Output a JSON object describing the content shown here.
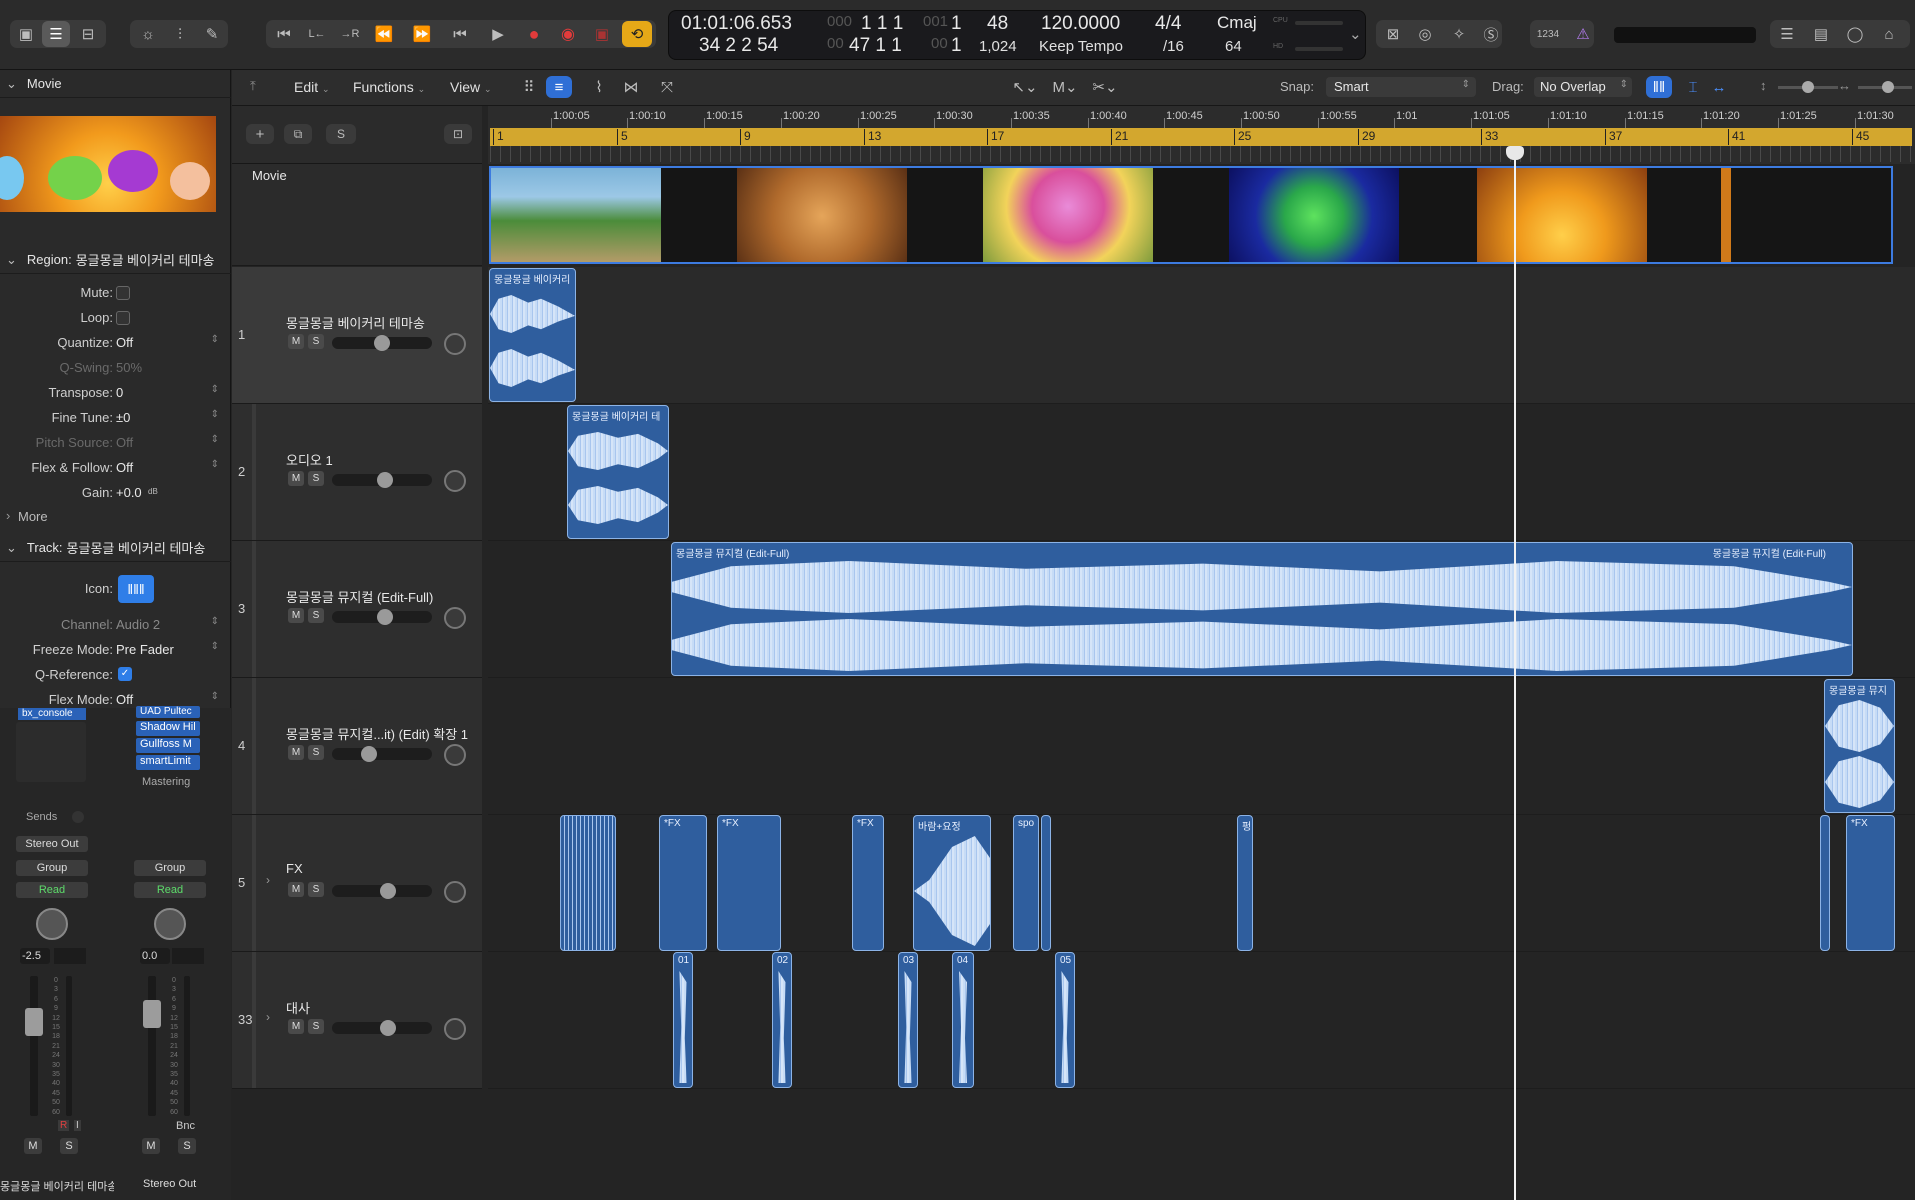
{
  "transport": {
    "time": "01:01:06.653",
    "time_sub": "34 2 2 54",
    "bar_top_dim": "000",
    "bar_top": "1  1  1",
    "bar_top_dim2": "001",
    "bar_bottom_dim": "00",
    "bar_bottom": "47  1  1",
    "bar_bottom_dim2": "00",
    "bar_top_last": "1",
    "bar_bottom_last": "1",
    "num_top": "48",
    "num_bottom": "1,024",
    "tempo": "120.0000",
    "tempo_mode": "Keep Tempo",
    "sig": "4/4",
    "division": "/16",
    "key": "Cmaj",
    "key_sub": "64",
    "cpu_label": "CPU",
    "hd_label": "HD",
    "count_label": "1234"
  },
  "toolbar": {
    "edit": "Edit",
    "functions": "Functions",
    "view": "View",
    "tool1": "M",
    "snap_label": "Snap:",
    "snap_value": "Smart",
    "drag_label": "Drag:",
    "drag_value": "No Overlap"
  },
  "inspector": {
    "movie_title": "Movie",
    "region_label": "Region:",
    "region_name": "몽글몽글 베이커리 테마송",
    "rows": [
      {
        "label": "Mute:",
        "value": "",
        "type": "check"
      },
      {
        "label": "Loop:",
        "value": "",
        "type": "check"
      },
      {
        "label": "Quantize:",
        "value": "Off",
        "type": "select"
      },
      {
        "label": "Q-Swing:",
        "value": "50%",
        "type": "dim"
      },
      {
        "label": "Transpose:",
        "value": "0",
        "type": "select"
      },
      {
        "label": "Fine Tune:",
        "value": "±0",
        "type": "select"
      },
      {
        "label": "Pitch Source:",
        "value": "Off",
        "type": "dimselect"
      },
      {
        "label": "Flex & Follow:",
        "value": "Off",
        "type": "select"
      },
      {
        "label": "Gain:",
        "value": "+0.0",
        "type": "text"
      }
    ],
    "gain_unit": "dB",
    "more": "More",
    "track_label": "Track:",
    "track_name": "몽글몽글 베이커리 테마송",
    "track_rows": [
      {
        "label": "Icon:",
        "value": ""
      },
      {
        "label": "Channel:",
        "value": "Audio 2"
      },
      {
        "label": "Freeze Mode:",
        "value": "Pre Fader"
      },
      {
        "label": "Q-Reference:",
        "value": "✓"
      },
      {
        "label": "Flex Mode:",
        "value": "Off"
      }
    ],
    "strips": {
      "plugin_left": "bx_console",
      "plugins_right": [
        "UAD Pultec",
        "Shadow Hil",
        "Gullfoss M",
        "smartLimit"
      ],
      "mastering": "Mastering",
      "sends": "Sends",
      "output": "Stereo Out",
      "group_left": "Group",
      "group_right": "Group",
      "read_left": "Read",
      "read_right": "Read",
      "value_left": "-2.5",
      "value_right": "0.0",
      "bnc": "Bnc",
      "r_label": "R",
      "i_label": "I",
      "name_left": "몽글몽글 베이커리 테마송",
      "name_right": "Stereo Out",
      "m": "M",
      "s": "S",
      "scale": [
        "0",
        "3",
        "6",
        "9",
        "12",
        "15",
        "18",
        "21",
        "24",
        "30",
        "35",
        "40",
        "45",
        "50",
        "60"
      ]
    }
  },
  "tracks_header": {
    "add": "+",
    "s": "S",
    "movie": "Movie"
  },
  "ruler": {
    "times": [
      "1:00:05",
      "1:00:10",
      "1:00:15",
      "1:00:20",
      "1:00:25",
      "1:00:30",
      "1:00:35",
      "1:00:40",
      "1:00:45",
      "1:00:50",
      "1:00:55",
      "1:01",
      "1:01:05",
      "1:01:10",
      "1:01:15",
      "1:01:20",
      "1:01:25",
      "1:01:30"
    ],
    "bars": [
      "1",
      "5",
      "9",
      "13",
      "17",
      "21",
      "25",
      "29",
      "33",
      "37",
      "41",
      "45"
    ]
  },
  "tracks": [
    {
      "num": "1",
      "name": "몽글몽글 베이커리 테마송",
      "m": "M",
      "s": "S",
      "vol": 0.5
    },
    {
      "num": "2",
      "name": "오디오 1",
      "m": "M",
      "s": "S",
      "vol": 0.53
    },
    {
      "num": "3",
      "name": "몽글몽글 뮤지컬 (Edit-Full)",
      "m": "M",
      "s": "S",
      "vol": 0.54
    },
    {
      "num": "4",
      "name": "몽글몽글 뮤지컬...it) (Edit) 확장 1",
      "m": "M",
      "s": "S",
      "vol": 0.34
    },
    {
      "num": "5",
      "name": "FX",
      "m": "M",
      "s": "S",
      "vol": 0.57
    },
    {
      "num": "33",
      "name": "대사",
      "m": "M",
      "s": "S",
      "vol": 0.57
    }
  ],
  "regions": {
    "r1": "몽글몽글 베이커리",
    "r2": "몽글몽글 베이커리 테",
    "r3a": "몽글몽글 뮤지컬 (Edit-Full)",
    "r3b": "몽글몽글 뮤지컬 (Edit-Full)",
    "r4": "몽글몽글 뮤지",
    "fx": [
      "*FX",
      "*FX",
      "*FX",
      "바람+요정",
      "spo",
      "펑",
      "*FX"
    ],
    "dialog": [
      "01",
      "02",
      "03",
      "04",
      "05"
    ]
  }
}
